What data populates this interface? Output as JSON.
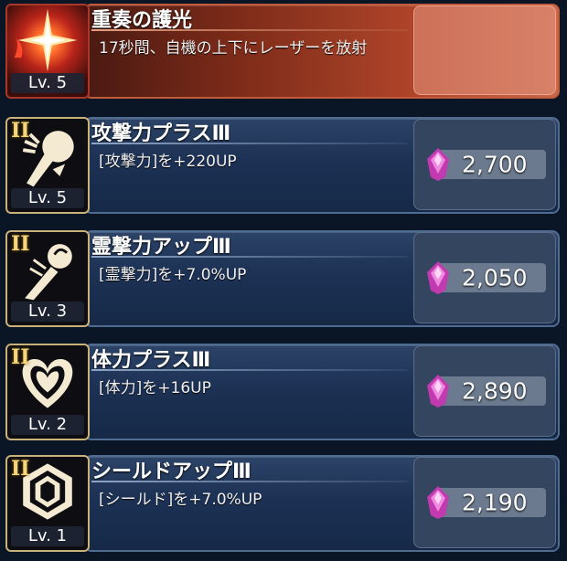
{
  "skills": [
    {
      "title": "重奏の護光",
      "desc": "17秒間、自機の上下にレーザーを放射",
      "level": "Lv. 5",
      "icon": "starburst-icon"
    },
    {
      "title": "攻撃力プラスⅢ",
      "desc": "[攻撃力]を+220UP",
      "level": "Lv. 5",
      "tier": "II",
      "cost": "2,700",
      "icon": "fist-icon"
    },
    {
      "title": "霊撃力アップⅢ",
      "desc": "[霊撃力]を+7.0%UP",
      "level": "Lv. 3",
      "tier": "II",
      "cost": "2,050",
      "icon": "orb-icon"
    },
    {
      "title": "体力プラスⅢ",
      "desc": "[体力]を+16UP",
      "level": "Lv. 2",
      "tier": "II",
      "cost": "2,890",
      "icon": "heart-icon"
    },
    {
      "title": "シールドアップⅢ",
      "desc": "[シールド]を+7.0%UP",
      "level": "Lv. 1",
      "tier": "II",
      "cost": "2,190",
      "icon": "shield-hexagon-icon"
    }
  ],
  "colors": {
    "gem": "#c23ab0",
    "tier": "#f5d67a",
    "highlight_row": "#b0452a"
  }
}
